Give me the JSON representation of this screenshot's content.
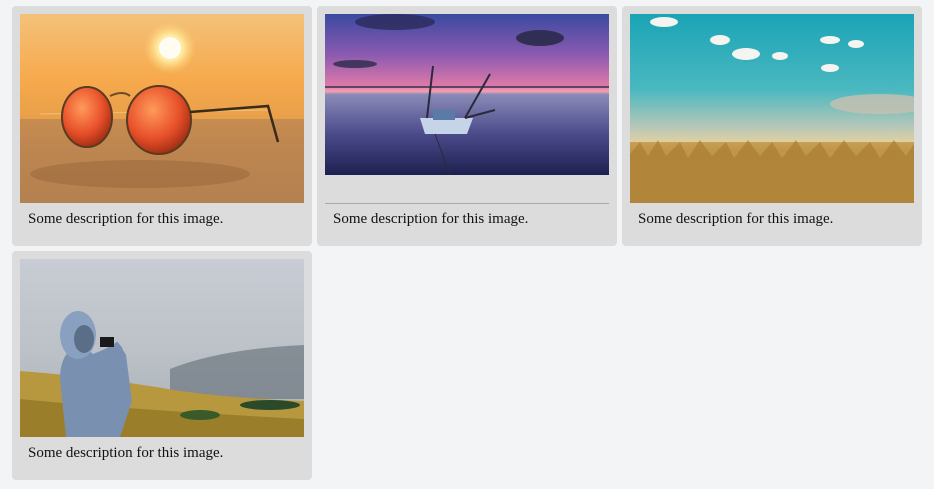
{
  "gallery": {
    "items": [
      {
        "description": "Some description for this image.",
        "image": "sunglasses-on-beach-at-sunset"
      },
      {
        "description": "Some description for this image.",
        "image": "boat-on-lake-at-dusk"
      },
      {
        "description": "Some description for this image.",
        "image": "golden-grass-field-under-blue-sky"
      },
      {
        "description": "Some description for this image.",
        "image": "person-in-hoodie-photographing-foggy-hills"
      }
    ]
  }
}
